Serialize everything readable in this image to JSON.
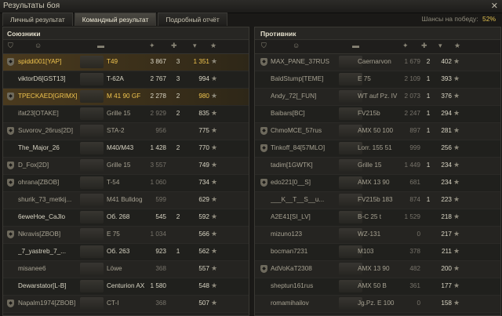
{
  "window": {
    "title": "Результаты боя",
    "close_glyph": "✕"
  },
  "tabs": [
    {
      "label": "Личный результат",
      "active": false
    },
    {
      "label": "Командный результат",
      "active": true
    },
    {
      "label": "Подробный отчёт",
      "active": false
    }
  ],
  "chance": {
    "label": "Шансы на победу:",
    "value": "52%"
  },
  "allies": {
    "title": "Союзники",
    "rows": [
      {
        "name": "spiddi001[YAP]",
        "tank": "T49",
        "dmg": "3 867",
        "frags": "3",
        "xp": "1 351",
        "clan": true,
        "highlight": true
      },
      {
        "name": "viktorD6[GST13]",
        "tank": "T-62A",
        "dmg": "2 767",
        "frags": "3",
        "xp": "994",
        "clan": false
      },
      {
        "name": "TPECKAED[GRIMX]",
        "tank": "M 41 90 GF",
        "dmg": "2 278",
        "frags": "2",
        "xp": "980",
        "clan": true,
        "highlight": true
      },
      {
        "name": "ifat23[OTAKE]",
        "tank": "Grille 15",
        "dmg": "2 929",
        "frags": "2",
        "xp": "835",
        "clan": false,
        "dead": true
      },
      {
        "name": "Suvorov_26rus[2D]",
        "tank": "STA-2",
        "dmg": "956",
        "frags": "",
        "xp": "775",
        "clan": true,
        "dead": true
      },
      {
        "name": "The_Major_26",
        "tank": "M40/M43",
        "dmg": "1 428",
        "frags": "2",
        "xp": "770",
        "clan": false
      },
      {
        "name": "D_Fox[2D]",
        "tank": "Grille 15",
        "dmg": "3 557",
        "frags": "",
        "xp": "749",
        "clan": true,
        "dead": true
      },
      {
        "name": "ohrana[ZBOB]",
        "tank": "T-54",
        "dmg": "1 060",
        "frags": "",
        "xp": "734",
        "clan": true,
        "dead": true
      },
      {
        "name": "shurik_73_metkij...",
        "tank": "M41 Bulldog",
        "dmg": "599",
        "frags": "",
        "xp": "629",
        "clan": false,
        "dead": true
      },
      {
        "name": "6eweHoe_CaJlo",
        "tank": "Об. 268",
        "dmg": "545",
        "frags": "2",
        "xp": "592",
        "clan": false
      },
      {
        "name": "Nkravis[ZBOB]",
        "tank": "E 75",
        "dmg": "1 034",
        "frags": "",
        "xp": "566",
        "clan": true,
        "dead": true
      },
      {
        "name": "_7_yastreb_7_...",
        "tank": "Об. 263",
        "dmg": "923",
        "frags": "1",
        "xp": "562",
        "clan": false
      },
      {
        "name": "misanee6",
        "tank": "Löwe",
        "dmg": "368",
        "frags": "",
        "xp": "557",
        "clan": false,
        "dead": true
      },
      {
        "name": "Dewarstator[L-B]",
        "tank": "Centurion AX",
        "dmg": "1 580",
        "frags": "",
        "xp": "548",
        "clan": false
      },
      {
        "name": "Napalm1974[ZBOB]",
        "tank": "CT-I",
        "dmg": "368",
        "frags": "",
        "xp": "507",
        "clan": true,
        "dead": true
      }
    ]
  },
  "enemies": {
    "title": "Противник",
    "rows": [
      {
        "name": "MAX_PANE_37RUS",
        "tank": "Caernarvon",
        "dmg": "1 679",
        "frags": "2",
        "xp": "402",
        "clan": true,
        "dead": true
      },
      {
        "name": "BaldStump[TEME]",
        "tank": "E 75",
        "dmg": "2 109",
        "frags": "1",
        "xp": "393",
        "clan": false,
        "dead": true
      },
      {
        "name": "Andy_72[_FUN]",
        "tank": "WT auf Pz. IV",
        "dmg": "2 073",
        "frags": "1",
        "xp": "376",
        "clan": false,
        "dead": true
      },
      {
        "name": "Baibars[BC]",
        "tank": "FV215b",
        "dmg": "2 247",
        "frags": "1",
        "xp": "294",
        "clan": false,
        "dead": true
      },
      {
        "name": "ChmoMCE_57rus",
        "tank": "AMX 50 100",
        "dmg": "897",
        "frags": "1",
        "xp": "281",
        "clan": true,
        "dead": true
      },
      {
        "name": "Tinkoff_84[57MLO]",
        "tank": "Lorr. 155 51",
        "dmg": "999",
        "frags": "",
        "xp": "256",
        "clan": true,
        "dead": true
      },
      {
        "name": "tadim[1GWTK]",
        "tank": "Grille 15",
        "dmg": "1 449",
        "frags": "1",
        "xp": "234",
        "clan": false,
        "dead": true
      },
      {
        "name": "edo221[0__S]",
        "tank": "AMX 13 90",
        "dmg": "681",
        "frags": "",
        "xp": "234",
        "clan": true,
        "dead": true
      },
      {
        "name": "___K__T__S__u...",
        "tank": "FV215b 183",
        "dmg": "874",
        "frags": "1",
        "xp": "223",
        "clan": false,
        "dead": true
      },
      {
        "name": "A2E41[SI_LV]",
        "tank": "B-C 25 t",
        "dmg": "1 529",
        "frags": "",
        "xp": "218",
        "clan": false,
        "dead": true
      },
      {
        "name": "mizuno123",
        "tank": "WZ-131",
        "dmg": "0",
        "frags": "",
        "xp": "217",
        "clan": false,
        "dead": true
      },
      {
        "name": "bocman7231",
        "tank": "M103",
        "dmg": "378",
        "frags": "",
        "xp": "211",
        "clan": false,
        "dead": true
      },
      {
        "name": "AdVoKaT2308",
        "tank": "AMX 13 90",
        "dmg": "482",
        "frags": "",
        "xp": "200",
        "clan": true,
        "dead": true
      },
      {
        "name": "sheptun161rus",
        "tank": "AMX 50 B",
        "dmg": "361",
        "frags": "",
        "xp": "177",
        "clan": false,
        "dead": true
      },
      {
        "name": "romamihailov",
        "tank": "Jg.Pz. E 100",
        "dmg": "0",
        "frags": "",
        "xp": "158",
        "clan": false,
        "dead": true
      }
    ]
  },
  "column_icons": [
    "clan-icon",
    "player-icon",
    "tank-icon",
    "damage-icon",
    "frags-icon",
    "sort-icon",
    "xp-star-icon"
  ],
  "colors": {
    "accent": "#f0c44e",
    "background": "#1a1917",
    "panel": "#22211f"
  }
}
